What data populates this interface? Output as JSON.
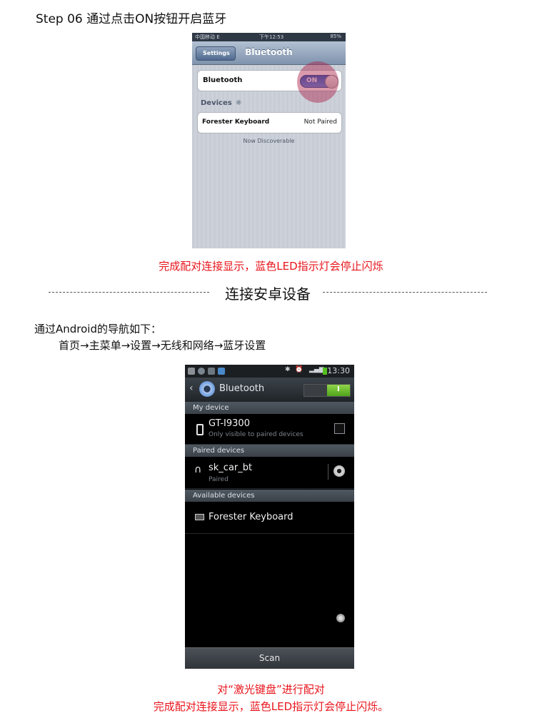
{
  "header": {
    "step_title": "Step 06   通过点击ON按钮开启蓝牙"
  },
  "ios_screen": {
    "status": {
      "carrier": "中国移动 E",
      "time": "下午12:53",
      "battery": "85%"
    },
    "back_label": "Settings",
    "title": "Bluetooth",
    "bluetooth_label": "Bluetooth",
    "switch_label": "ON",
    "devices_header": "Devices",
    "device_name": "Forester Keyboard",
    "device_status": "Not Paired",
    "discoverable_text": "Now Discoverable"
  },
  "caption_1": "完成配对连接显示，蓝色LED指示灯会停止闪烁",
  "divider_title": "连接安卓设备",
  "nav_intro": "通过Android的导航如下：",
  "nav_path": "首页→主菜单→设置→无线和网络→蓝牙设置",
  "android_screen": {
    "status": {
      "time": "13:30"
    },
    "title": "Bluetooth",
    "toggle_label": "I",
    "section_my_device": "My device",
    "my_device_name": "GT-I9300",
    "my_device_sub": "Only visible to paired devices",
    "section_paired": "Paired devices",
    "paired_name": "sk_car_bt",
    "paired_sub": "Paired",
    "section_available": "Available devices",
    "available_name": "Forester Keyboard",
    "scan_label": "Scan"
  },
  "caption_2a": "对“激光键盘”进行配对",
  "caption_2b": "完成配对连接显示，蓝色LED指示灯会停止闪烁。",
  "colors": {
    "caption_red": "#e8141b",
    "ios_switch_blue": "#2b63c3",
    "android_toggle_green": "#4fa31a"
  },
  "icons": [
    "gear-icon",
    "phone-icon",
    "headphones-icon",
    "keyboard-icon",
    "chevron-left-icon",
    "spinner-icon"
  ]
}
